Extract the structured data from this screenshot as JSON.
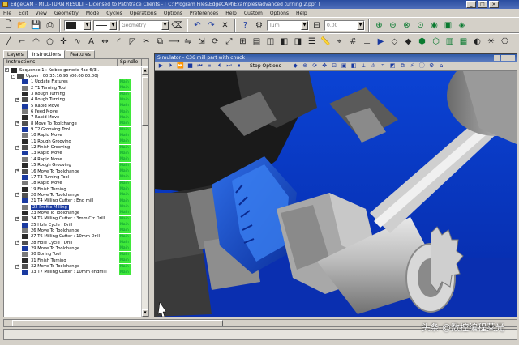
{
  "window": {
    "title": "EdgeCAM - MILL-TURN RESULT - Licensed to Pathtrace Clients - [ C:\\Program Files\\EdgeCAM\\Examples\\advanced turning 2.ppf ]"
  },
  "menu": [
    "File",
    "Edit",
    "View",
    "Geometry",
    "Mode",
    "Cycles",
    "Operations",
    "Options",
    "Preferences",
    "Help",
    "Custom",
    "Options",
    "Help"
  ],
  "toolbar": {
    "geometry_combo": "Geometry",
    "turn_combo": "Turn",
    "value_combo": "0.00"
  },
  "left_panel": {
    "tabs": [
      "Layers",
      "Instructions",
      "Features"
    ],
    "active_tab": "Instructions",
    "columns": [
      "Instructions",
      "Spindle"
    ],
    "tree": [
      {
        "label": "Sequence 1 : Kolbes generic 4ax 6/3..",
        "level": 0,
        "exp": true,
        "spindle": ""
      },
      {
        "label": "Upper : 00:35:16.96 (00:00:00.00)",
        "level": 1,
        "exp": true,
        "spindle": ""
      },
      {
        "label": "1 Update Fixtures",
        "level": 2,
        "spindle": "Main"
      },
      {
        "label": "2 T1 Turning Tool",
        "level": 2,
        "spindle": "Main"
      },
      {
        "label": "3 Rough Turning",
        "level": 2,
        "spindle": "Main"
      },
      {
        "label": "4 Rough Turning",
        "level": 2,
        "spindle": "Main"
      },
      {
        "label": "5 Rapid Move",
        "level": 2,
        "spindle": "Main"
      },
      {
        "label": "6 Feed Move",
        "level": 2,
        "spindle": "Main"
      },
      {
        "label": "7 Rapid Move",
        "level": 2,
        "spindle": "Main"
      },
      {
        "label": "8 Move To Toolchange",
        "level": 2,
        "spindle": "Main"
      },
      {
        "label": "9 T2 Grooving Tool",
        "level": 2,
        "spindle": "Main"
      },
      {
        "label": "10 Rapid Move",
        "level": 2,
        "spindle": "Main"
      },
      {
        "label": "11 Rough Grooving",
        "level": 2,
        "spindle": "Main"
      },
      {
        "label": "12 Finish Grooving",
        "level": 2,
        "spindle": "Main"
      },
      {
        "label": "13 Rapid Move",
        "level": 2,
        "spindle": "Main"
      },
      {
        "label": "14 Rapid Move",
        "level": 2,
        "spindle": "Main"
      },
      {
        "label": "15 Rough Grooving",
        "level": 2,
        "spindle": "Main"
      },
      {
        "label": "16 Move To Toolchange",
        "level": 2,
        "spindle": "Main"
      },
      {
        "label": "17 T3 Turning Tool",
        "level": 2,
        "spindle": "Main"
      },
      {
        "label": "18 Rapid Move",
        "level": 2,
        "spindle": "Main"
      },
      {
        "label": "19 Finish Turning",
        "level": 2,
        "spindle": "Main"
      },
      {
        "label": "20 Move To Toolchange",
        "level": 2,
        "spindle": "Main"
      },
      {
        "label": "21 T4 Milling Cutter : End mill",
        "level": 2,
        "spindle": "Main"
      },
      {
        "label": "22 Profile Milling",
        "level": 2,
        "spindle": "Main",
        "selected": true
      },
      {
        "label": "23 Move To Toolchange",
        "level": 2,
        "spindle": "Main"
      },
      {
        "label": "24 T5 Milling Cutter : 3mm Ctr Drill",
        "level": 2,
        "spindle": "Main"
      },
      {
        "label": "25 Hole Cycle : Drill",
        "level": 2,
        "spindle": "Main"
      },
      {
        "label": "26 Move To Toolchange",
        "level": 2,
        "spindle": "Main"
      },
      {
        "label": "27 T6 Milling Cutter : 10mm Drill",
        "level": 2,
        "spindle": "Main"
      },
      {
        "label": "28 Hole Cycle : Drill",
        "level": 2,
        "spindle": "Main"
      },
      {
        "label": "29 Move To Toolchange",
        "level": 2,
        "spindle": "Main"
      },
      {
        "label": "30 Boring Tool",
        "level": 2,
        "spindle": "Main"
      },
      {
        "label": "31 Finish Turning",
        "level": 2,
        "spindle": "Main"
      },
      {
        "label": "32 Move To Toolchange",
        "level": 2,
        "spindle": "Main"
      },
      {
        "label": "33 T7 Milling Cutter : 10mm endmill",
        "level": 2,
        "spindle": "Main"
      }
    ]
  },
  "simulator": {
    "title": "Simulator - C36 mill part with chuck",
    "stop_options": "Stop Options"
  },
  "watermark": {
    "text": "头条 @数控编程莱光"
  },
  "colors": {
    "spindle_green": "#3fe83a",
    "viewport_blue": "#0b43d4",
    "title_blue": "#2a4ea0"
  }
}
